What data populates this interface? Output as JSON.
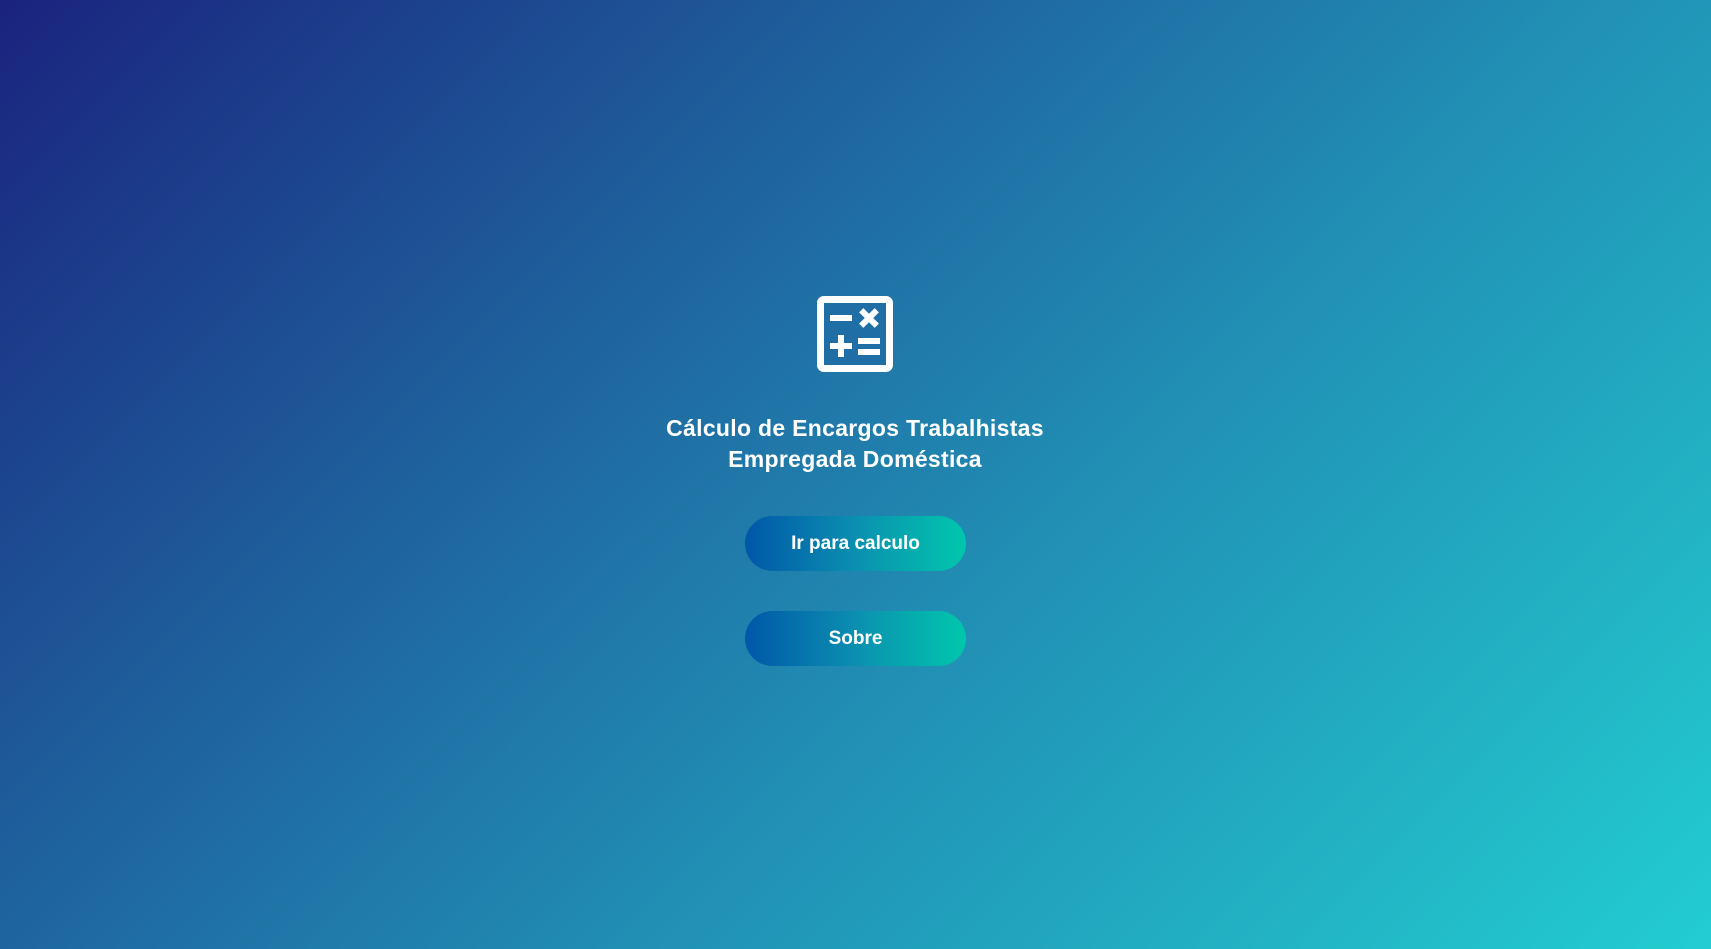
{
  "app": {
    "icon": "calculator-icon",
    "title_line1": "Cálculo de Encargos Trabalhistas",
    "title_line2": "Empregada Doméstica"
  },
  "buttons": {
    "calculate_label": "Ir para calculo",
    "about_label": "Sobre"
  },
  "colors": {
    "background_start": "#1a237e",
    "background_end": "#22cdd0",
    "button_start": "#0057a8",
    "button_end": "#00c7ad",
    "text": "#ffffff"
  }
}
